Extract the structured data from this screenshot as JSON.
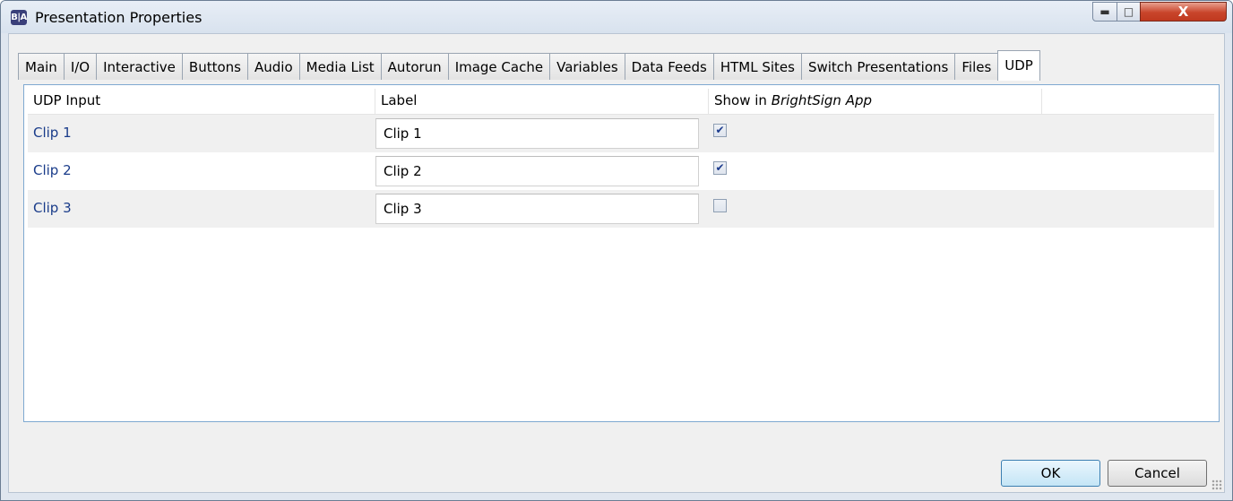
{
  "window": {
    "title": "Presentation Properties",
    "icon_text": "B|A",
    "close_glyph": "X"
  },
  "tabs": [
    "Main",
    "I/O",
    "Interactive",
    "Buttons",
    "Audio",
    "Media List",
    "Autorun",
    "Image Cache",
    "Variables",
    "Data Feeds",
    "HTML Sites",
    "Switch Presentations",
    "Files",
    "UDP"
  ],
  "active_tab": "UDP",
  "grid": {
    "headers": {
      "udp_input": "UDP Input",
      "label": "Label",
      "show_prefix": "Show in ",
      "show_app": "BrightSign App"
    },
    "rows": [
      {
        "input": "Clip 1",
        "label": "Clip 1",
        "show": true
      },
      {
        "input": "Clip 2",
        "label": "Clip 2",
        "show": true
      },
      {
        "input": "Clip 3",
        "label": "Clip 3",
        "show": false
      }
    ]
  },
  "buttons": {
    "ok": "OK",
    "cancel": "Cancel"
  },
  "colors": {
    "accent": "#1a3c8a",
    "close": "#c9452b"
  }
}
